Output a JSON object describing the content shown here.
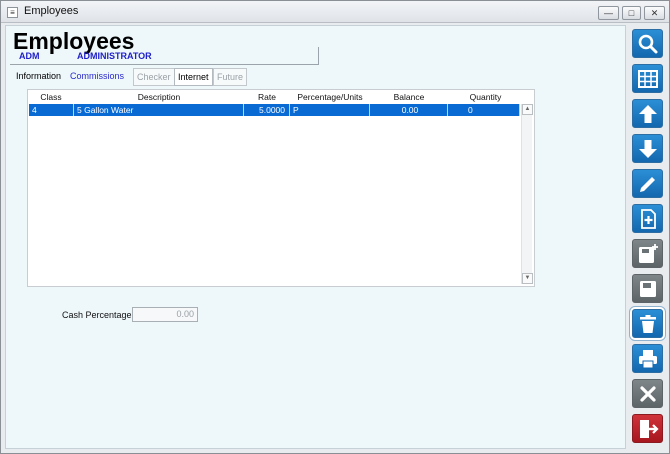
{
  "window": {
    "title": "Employees"
  },
  "page": {
    "title": "Employees"
  },
  "employee": {
    "id": "ADM",
    "name": "ADMINISTRATOR"
  },
  "tabs": [
    {
      "label": "Information",
      "state": "normal"
    },
    {
      "label": "Commissions",
      "state": "active"
    },
    {
      "label": "Checker",
      "state": "disabled"
    },
    {
      "label": "Internet",
      "state": "normal"
    },
    {
      "label": "Future",
      "state": "disabled"
    }
  ],
  "table": {
    "columns": [
      "Class",
      "Description",
      "Rate",
      "Percentage/Units",
      "Balance",
      "Quantity"
    ],
    "rows": [
      {
        "class": "4",
        "description": "5 Gallon Water",
        "rate": "5.0000",
        "percentage_units": "P",
        "balance": "0.00",
        "quantity": "0"
      }
    ]
  },
  "cash_percentage": {
    "label": "Cash Percentage",
    "value": "0.00"
  },
  "toolbar": [
    {
      "icon": "search-icon",
      "color": "#1b7bc4"
    },
    {
      "icon": "grid-icon",
      "color": "#1b7bc4"
    },
    {
      "icon": "arrow-up-icon",
      "color": "#1b7bc4"
    },
    {
      "icon": "arrow-down-icon",
      "color": "#1b7bc4"
    },
    {
      "icon": "pencil-icon",
      "color": "#1b7bc4"
    },
    {
      "icon": "add-document-icon",
      "color": "#1b7bc4"
    },
    {
      "icon": "save-add-icon",
      "color": "#6b7276"
    },
    {
      "icon": "save-icon",
      "color": "#6b7276"
    },
    {
      "icon": "trash-icon",
      "color": "#1b7bc4"
    },
    {
      "icon": "print-icon",
      "color": "#1b7bc4"
    },
    {
      "icon": "close-x-icon",
      "color": "#6b7276"
    },
    {
      "icon": "exit-door-icon",
      "color": "#b51f27"
    }
  ]
}
